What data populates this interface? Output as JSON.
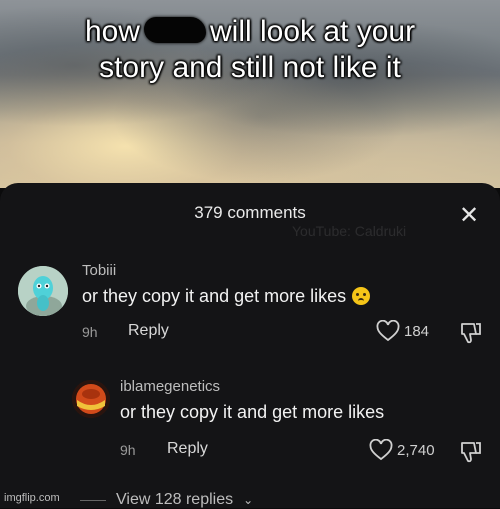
{
  "caption": {
    "line1_part1": "how",
    "line1_part2": "will look at your",
    "line2": "story and still not like it"
  },
  "sheet": {
    "comments_count": "379 comments",
    "close_icon": "close-icon",
    "watermark": "YouTube: Caldruki"
  },
  "comments": [
    {
      "username": "Tobiii",
      "text": "or they copy it and get more likes",
      "emoji": "crying-face-emoji",
      "time": "9h",
      "reply_label": "Reply",
      "likes": "184"
    },
    {
      "username": "iblamegenetics",
      "text": "or they copy it and get more likes",
      "time": "9h",
      "reply_label": "Reply",
      "likes": "2,740"
    }
  ],
  "view_replies": "View 128 replies",
  "credit": "imgflip.com",
  "colors": {
    "sheet_bg": "#141416",
    "text_primary": "#f2f2f2",
    "text_secondary": "#9a9a9a"
  }
}
